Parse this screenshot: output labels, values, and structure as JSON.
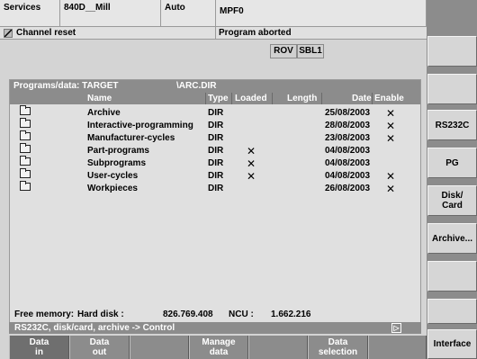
{
  "header": {
    "area": "Services",
    "machine": "840D__Mill",
    "mode": "Auto",
    "program": "MPF0",
    "channel_status": "Channel reset",
    "program_status": "Program aborted",
    "flags": [
      "ROV",
      "SBL1"
    ]
  },
  "panel": {
    "path_label": "Programs/data: TARGET",
    "path_file": "\\ARC.DIR",
    "columns": {
      "name": "Name",
      "type": "Type",
      "loaded": "Loaded",
      "length": "Length",
      "date": "Date",
      "enable": "Enable"
    },
    "rows": [
      {
        "name": "Archive",
        "type": "DIR",
        "loaded": "",
        "length": "",
        "date": "25/08/2003",
        "enable": "✕"
      },
      {
        "name": "Interactive-programming",
        "type": "DIR",
        "loaded": "",
        "length": "",
        "date": "28/08/2003",
        "enable": "✕"
      },
      {
        "name": "Manufacturer-cycles",
        "type": "DIR",
        "loaded": "",
        "length": "",
        "date": "23/08/2003",
        "enable": "✕"
      },
      {
        "name": "Part-programs",
        "type": "DIR",
        "loaded": "✕",
        "length": "",
        "date": "04/08/2003",
        "enable": ""
      },
      {
        "name": "Subprograms",
        "type": "DIR",
        "loaded": "✕",
        "length": "",
        "date": "04/08/2003",
        "enable": ""
      },
      {
        "name": "User-cycles",
        "type": "DIR",
        "loaded": "✕",
        "length": "",
        "date": "04/08/2003",
        "enable": "✕"
      },
      {
        "name": "Workpieces",
        "type": "DIR",
        "loaded": "",
        "length": "",
        "date": "26/08/2003",
        "enable": "✕"
      }
    ],
    "memory": {
      "label": "Free memory:",
      "hd_label": "Hard disk :",
      "hd_value": "826.769.408",
      "ncu_label": "NCU :",
      "ncu_value": "1.662.216"
    }
  },
  "status_line": "RS232C, disk/card, archive -> Control",
  "status_icon": "▷",
  "softkeys_bottom": [
    {
      "line1": "Data",
      "line2": "in",
      "active": true
    },
    {
      "line1": "Data",
      "line2": "out",
      "active": false
    },
    {
      "line1": "",
      "line2": "",
      "active": false
    },
    {
      "line1": "Manage",
      "line2": "data",
      "active": false
    },
    {
      "line1": "",
      "line2": "",
      "active": false
    },
    {
      "line1": "Data",
      "line2": "selection",
      "active": false
    },
    {
      "line1": "",
      "line2": "",
      "active": false
    }
  ],
  "softkeys_right": [
    {
      "line1": "",
      "line2": ""
    },
    {
      "line1": "",
      "line2": ""
    },
    {
      "line1": "RS232C",
      "line2": ""
    },
    {
      "line1": "PG",
      "line2": ""
    },
    {
      "line1": "Disk/",
      "line2": "Card"
    },
    {
      "line1": "Archive...",
      "line2": ""
    },
    {
      "line1": "",
      "line2": ""
    },
    {
      "line1": "",
      "line2": ""
    },
    {
      "line1": "Interface",
      "line2": ""
    }
  ]
}
